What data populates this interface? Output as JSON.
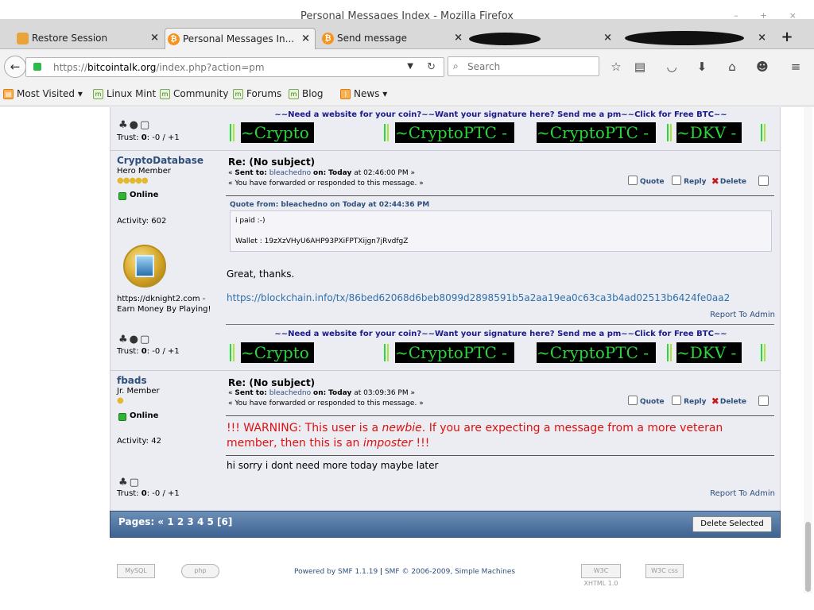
{
  "window": {
    "title": "Personal Messages Index - Mozilla Firefox"
  },
  "tabs": [
    {
      "label": "Restore Session",
      "icon": "restore-session-icon"
    },
    {
      "label": "Personal Messages In...",
      "icon": "bitcoin-icon"
    },
    {
      "label": "Send message",
      "icon": "bitcoin-icon"
    },
    {
      "label": "",
      "icon": "redacted"
    },
    {
      "label": "",
      "icon": "redacted"
    }
  ],
  "nav": {
    "url_prefix": "https://",
    "url_host": "bitcointalk.org",
    "url_path": "/index.php?action=pm",
    "search_placeholder": "Search"
  },
  "bookmarks": [
    {
      "label": "Most Visited ▾"
    },
    {
      "label": "Linux Mint"
    },
    {
      "label": "Community"
    },
    {
      "label": "Forums"
    },
    {
      "label": "Blog"
    },
    {
      "label": "News ▾"
    }
  ],
  "signature": {
    "top_line": "~~Need a website for your coin?~~Want your signature here? Send me a pm~~Click for Free BTC~~",
    "banners": [
      "~Crypto",
      "~CryptoPTC -",
      "~CryptoPTC -",
      "~DKV -"
    ]
  },
  "prev_post_footer": {
    "trust_label": "Trust:",
    "trust_value": "0",
    "trust_rest": ": -0 / +1"
  },
  "message1": {
    "poster": "CryptoDatabase",
    "rank": "Hero Member",
    "stars": "●●●●●",
    "status": "Online",
    "activity": "Activity: 602",
    "sig_line1": "https://dknight2.com -",
    "sig_line2": "Earn Money By Playing!",
    "subject": "Re: (No subject)",
    "meta_prefix": "« ",
    "sent_to_label": "Sent to:",
    "sent_to_user": "bleachedno",
    "on_label": "on:",
    "date": "Today",
    "time": "at 02:46:00 PM »",
    "forward_note": "« You have forwarded or responded to this message. »",
    "quote_label": "Quote",
    "reply_label": "Reply",
    "delete_label": "Delete",
    "quote_header": "Quote from: bleachedno on Today at 02:44:36 PM",
    "quote_line1": "i paid :-)",
    "quote_line2": "Wallet : 19zXzVHyU6AHP93PXiFPTXijgn7jRvdfgZ",
    "body": "Great, thanks.",
    "link": "https://blockchain.info/tx/86bed62068d6beb8099d2898591b5a2aa19ea0c63ca3b4ad02513b6424fe0aa2",
    "report": "Report To Admin",
    "trust_label": "Trust:",
    "trust_value": "0",
    "trust_rest": ": -0 / +1"
  },
  "message2": {
    "poster": "fbads",
    "rank": "Jr. Member",
    "stars": "●",
    "status": "Online",
    "activity": "Activity: 42",
    "subject": "Re: (No subject)",
    "meta_prefix": "« ",
    "sent_to_label": "Sent to:",
    "sent_to_user": "bleachedno",
    "on_label": "on:",
    "date": "Today",
    "time": "at 03:09:36 PM »",
    "forward_note": "« You have forwarded or responded to this message. »",
    "quote_label": "Quote",
    "reply_label": "Reply",
    "delete_label": "Delete",
    "warning_prefix": "!!! WARNING: This user is a ",
    "warning_newbie": "newbie",
    "warning_mid": ". If you are expecting a message from a more veteran member, then this is an ",
    "warning_imposter": "imposter",
    "warning_suffix": " !!!",
    "body": "hi sorry i dont need more today maybe later",
    "report": "Report To Admin",
    "trust_label": "Trust:",
    "trust_value": "0",
    "trust_rest": ": -0 / +1"
  },
  "pagination": {
    "label": "Pages: « ",
    "pages": "1 2 3 4 5",
    "current": "[6]",
    "delete_button": "Delete Selected"
  },
  "footer": {
    "powered_by": "Powered by SMF 1.1.19",
    "separator": " | ",
    "copyright": "SMF © 2006-2009, Simple Machines",
    "badges": [
      "MySQL",
      "php",
      "W3C XHTML 1.0",
      "W3C css"
    ]
  },
  "colors": {
    "accent": "#2f4f7c",
    "warning": "#dd1111",
    "banner_text": "#29d63b",
    "page_bar": "#3e6392"
  }
}
